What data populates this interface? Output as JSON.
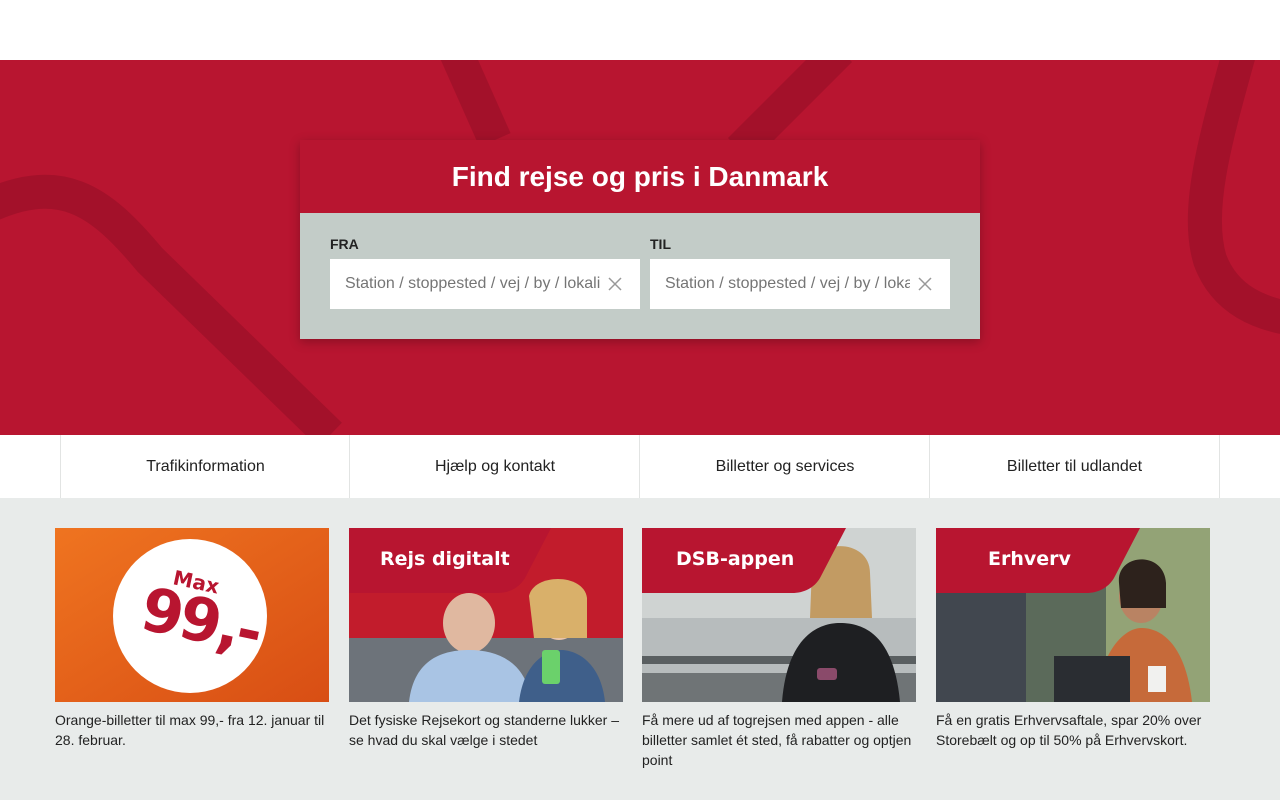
{
  "hero": {
    "title": "Find rejse og pris i Danmark",
    "from_label": "FRA",
    "from_placeholder": "Station / stoppested / vej / by / lokalitet",
    "to_label": "TIL",
    "to_placeholder": "Station / stoppested / vej / by / lokalitet"
  },
  "nav": {
    "items": [
      {
        "label": "Trafikinformation"
      },
      {
        "label": "Hjælp og kontakt"
      },
      {
        "label": "Billetter og services"
      },
      {
        "label": "Billetter til udlandet"
      }
    ]
  },
  "promos": [
    {
      "badge_top": "Max",
      "badge_main": "99,-",
      "text": "Orange-billetter til max 99,- fra 12. januar til 28. februar."
    },
    {
      "banner": "Rejs digitalt",
      "text": "Det fysiske Rejsekort og standerne lukker – se hvad du skal vælge i stedet"
    },
    {
      "banner": "DSB-appen",
      "text": "Få mere ud af togrejsen med appen - alle billetter samlet ét sted, få rabatter og optjen point"
    },
    {
      "banner": "Erhverv",
      "text": "Få en gratis Erhvervsaftale, spar 20% over Storebælt og op til 50% på Erhvervskort."
    }
  ],
  "colors": {
    "brand_red": "#b81530",
    "search_panel": "#c3ccc8",
    "promo_bg": "#e8ebea",
    "orange": "#e55c1a"
  },
  "icons": {
    "clear": "close-icon"
  }
}
